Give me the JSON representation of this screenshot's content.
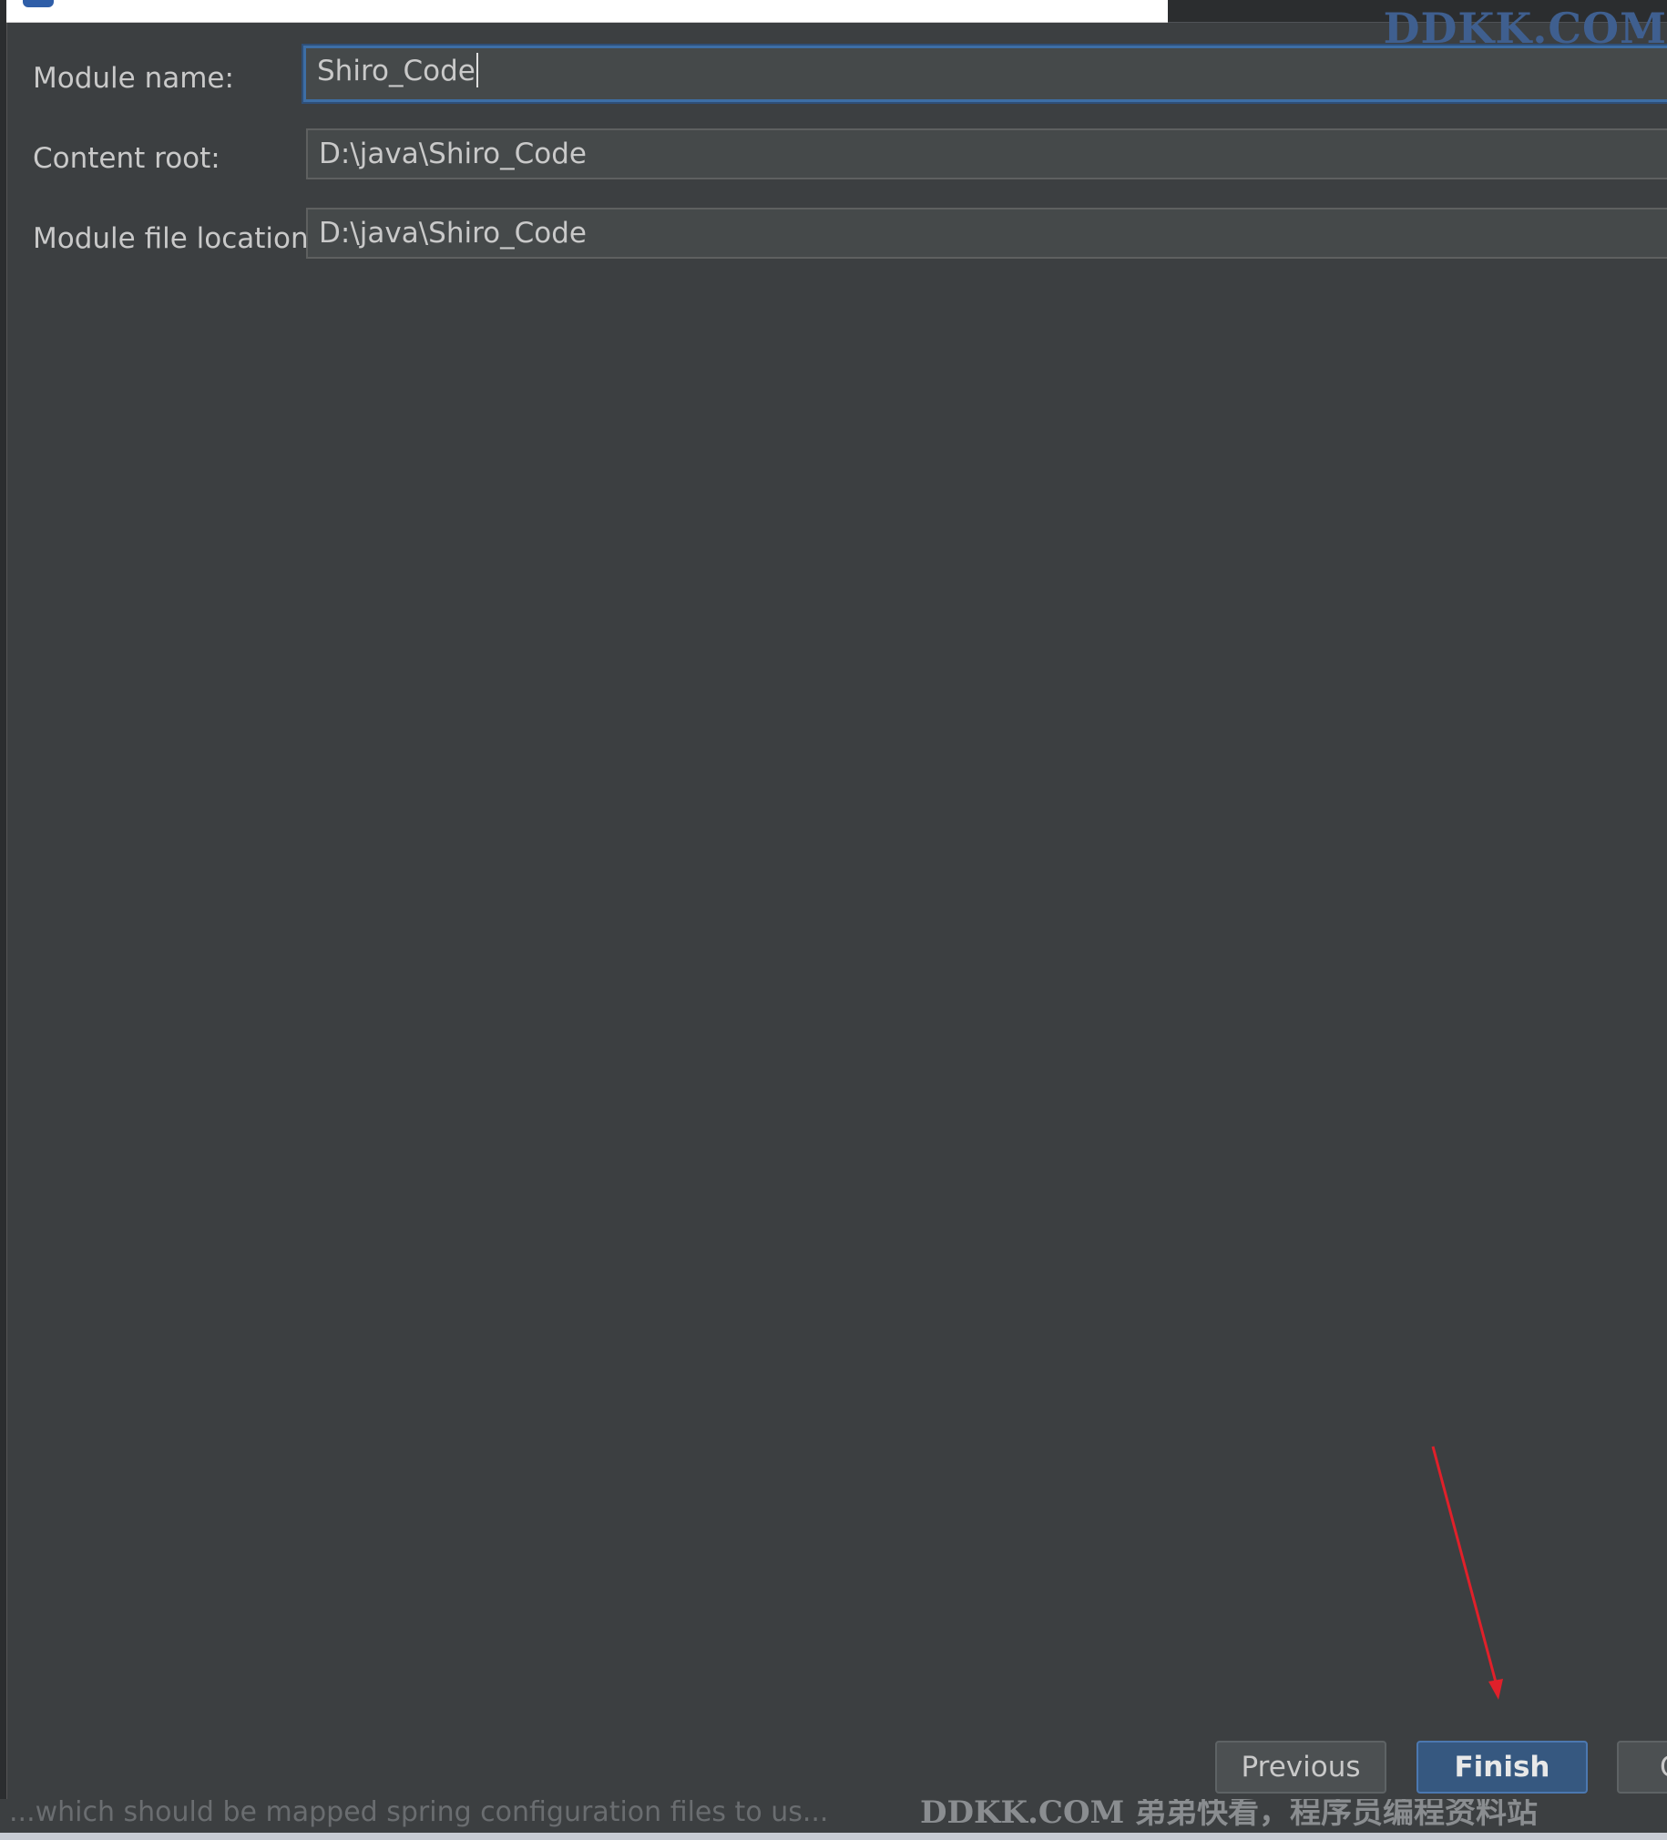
{
  "form": {
    "module_name_label": "Module name:",
    "module_name_value": "Shiro_Code",
    "content_root_label": "Content root:",
    "content_root_value": "D:\\java\\Shiro_Code",
    "module_file_location_label": "Module file location:",
    "module_file_location_value": "D:\\java\\Shiro_Code"
  },
  "buttons": {
    "previous": "Previous",
    "finish": "Finish",
    "cancel": "C"
  },
  "watermark": {
    "top": "DDKK.COM",
    "bottom": "DDKK.COM 弟弟快看，程序员编程资料站"
  },
  "status": {
    "text": "...which should be mapped spring configuration files to us..."
  },
  "colors": {
    "background": "#3c3f41",
    "field": "#45494a",
    "focus_border": "#3d6ea5",
    "primary_button": "#365880",
    "annotation_arrow": "#e0202a"
  }
}
